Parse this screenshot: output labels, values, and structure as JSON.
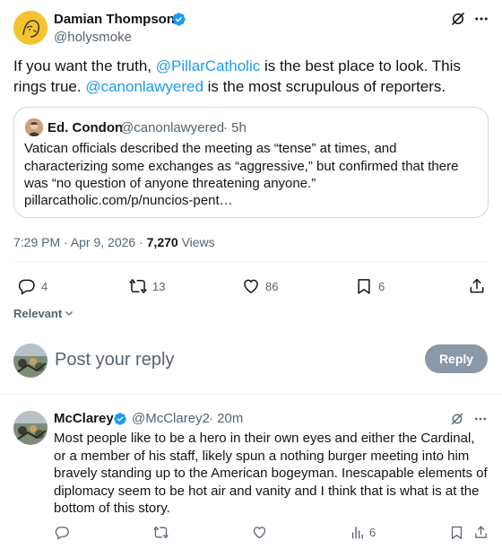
{
  "main_tweet": {
    "author_name": "Damian Thompson",
    "author_handle": "@holysmoke",
    "text_parts": {
      "p1": "If you want the truth, ",
      "m1": "@PillarCatholic",
      "p2": " is the best place to look. This rings true. ",
      "m2": "@canonlawyered",
      "p3": " is the most scrupulous of reporters."
    },
    "timestamp": "7:29 PM · Apr 9, 2026 · ",
    "view_count": "7,270",
    "views_label": " Views",
    "actions": {
      "replies": "4",
      "reposts": "13",
      "likes": "86",
      "bookmarks": "6"
    }
  },
  "quoted_tweet": {
    "author_name": "Ed. Condon",
    "author_handle": "@canonlawyered",
    "time": "· 5h",
    "text": "Vatican officials described the meeting as “tense” at times, and characterizing some exchanges as “aggressive,” but confirmed that there was “no question of anyone threatening anyone.”",
    "link": "pillarcatholic.com/p/nuncios-pent…"
  },
  "sort": {
    "label": "Relevant"
  },
  "composer": {
    "placeholder": "Post your reply",
    "reply_button": "Reply"
  },
  "reply_tweet": {
    "author_name": "McClarey",
    "author_handle": "@McClarey2",
    "time": "· 20m",
    "text": "Most people like to be a hero in their own eyes and either the Cardinal, or a member of his staff, likely spun a nothing burger meeting into him bravely standing up to the American bogeyman.  Inescapable elements of diplomacy seem to be hot air and vanity and I think that is what is at the bottom of this story.",
    "views": "6"
  },
  "colors": {
    "accent": "#1d9bf0",
    "text": "#0f1419",
    "muted": "#536471",
    "border": "#cfd9de",
    "reply_button_bg": "#8b98a5"
  }
}
